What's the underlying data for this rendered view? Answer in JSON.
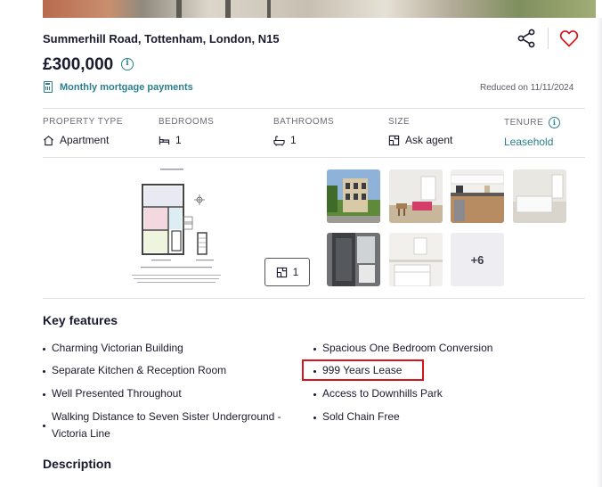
{
  "listing": {
    "address": "Summerhill Road, Tottenham, London, N15",
    "price": "£300,000",
    "mortgage_link": "Monthly mortgage payments",
    "reduced": "Reduced on 11/11/2024"
  },
  "details": {
    "property_type": {
      "label": "PROPERTY TYPE",
      "value": "Apartment",
      "icon": "house-icon"
    },
    "bedrooms": {
      "label": "BEDROOMS",
      "value": "1",
      "icon": "bed-icon"
    },
    "bathrooms": {
      "label": "BATHROOMS",
      "value": "1",
      "icon": "bath-icon"
    },
    "size": {
      "label": "SIZE",
      "value": "Ask agent",
      "icon": "floorplan-size-icon"
    },
    "tenure": {
      "label": "TENURE",
      "value": "Leasehold",
      "icon": "info-icon"
    }
  },
  "media": {
    "floorplan_count": "1",
    "more_photos": "+6"
  },
  "key_features": {
    "title": "Key features",
    "left": [
      "Charming Victorian Building",
      "Separate Kitchen & Reception Room",
      "Well Presented Throughout",
      "Walking Distance to Seven Sister Underground - Victoria Line"
    ],
    "right": [
      "Spacious One Bedroom Conversion",
      "999 Years Lease",
      "Access to Downhills Park",
      "Sold Chain Free"
    ]
  },
  "description": {
    "title": "Description"
  },
  "colors": {
    "accent": "#2a7f8f",
    "heart": "#d4151b",
    "highlight": "#d4151b"
  }
}
